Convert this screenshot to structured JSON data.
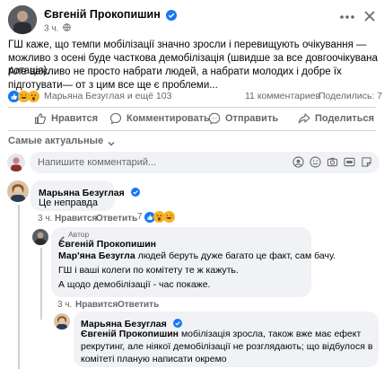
{
  "post": {
    "author": "Євгеній Прокопишин",
    "time": "3 ч.",
    "paragraph1": "ГШ каже, що темпи мобілізації значно зросли і перевищують очікування — можливо з осені буде часткова демобілізація (швидше за все довгоочікувана ротація).",
    "paragraph2": "Але важливо не просто набрати людей, а набрати молодих і добре їх підготувати— от з цим все ще є проблеми...",
    "reactions_label": "Марьяна Безуглая и ещё 103",
    "comments_count": "11 комментариев",
    "shares_count": "Поделились: 7"
  },
  "actions": {
    "like": "Нравится",
    "comment": "Комментировать",
    "send": "Отправить",
    "share": "Поделиться"
  },
  "sort": {
    "label": "Самые актуальные"
  },
  "composer": {
    "placeholder": "Напишите комментарий..."
  },
  "comments": [
    {
      "author": "Марьяна Безуглая",
      "text": "Це неправда",
      "time": "3 ч.",
      "like": "Нравится",
      "reply": "Ответить",
      "reaction_count": "7"
    },
    {
      "badge": "Автор",
      "author": "Євгеній Прокопишин",
      "mention": "Мар'яна Безугла",
      "text1": " людей беруть дуже багато це факт, сам бачу.",
      "text2": "ГШ і ваші колеги по комітету те ж кажуть.",
      "text3": "А щодо демобілізації - час покаже.",
      "time": "3 ч.",
      "like": "Нравится",
      "reply": "Ответить"
    },
    {
      "author": "Марьяна Безуглая",
      "mention": "Євгеній Прокопишин",
      "text": " мобілізація зросла, також вже має ефект рекрутинг, але ніякої демобілізації не розглядають; що відбулося в комітеті планую написати окремо"
    }
  ],
  "colors": {
    "accent": "#1877f2",
    "bubble": "#f0f2f5",
    "muted": "#65676b"
  }
}
